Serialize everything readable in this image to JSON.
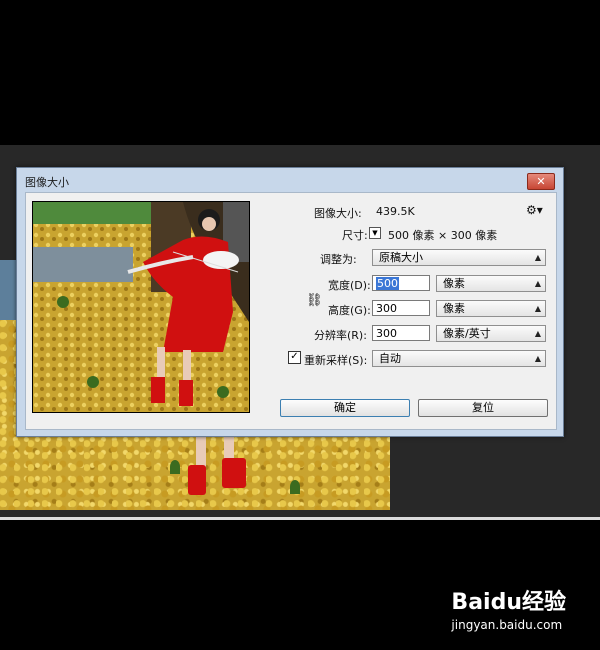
{
  "dialog": {
    "title": "图像大小",
    "close_label": "✕",
    "image_size_label": "图像大小:",
    "image_size_value": "439.5K",
    "dimensions_label": "尺寸:",
    "dimensions_value": "500 像素 × 300 像素",
    "fit_to_label": "调整为:",
    "fit_to_value": "原稿大小",
    "width_label": "宽度(D):",
    "width_value": "500",
    "width_unit": "像素",
    "height_label": "高度(G):",
    "height_value": "300",
    "height_unit": "像素",
    "resolution_label": "分辨率(R):",
    "resolution_value": "300",
    "resolution_unit": "像素/英寸",
    "resample_label": "重新采样(S):",
    "resample_value": "自动",
    "resample_checked": true,
    "ok_label": "确定",
    "reset_label": "复位"
  },
  "watermark": {
    "logo_text": "Baidu经验",
    "url": "jingyan.baidu.com"
  },
  "colors": {
    "workspace": "#282828",
    "dialog_frame": "#c7d7ea",
    "dress_red": "#d01010",
    "ginkgo_yellow": "#c9a430"
  }
}
